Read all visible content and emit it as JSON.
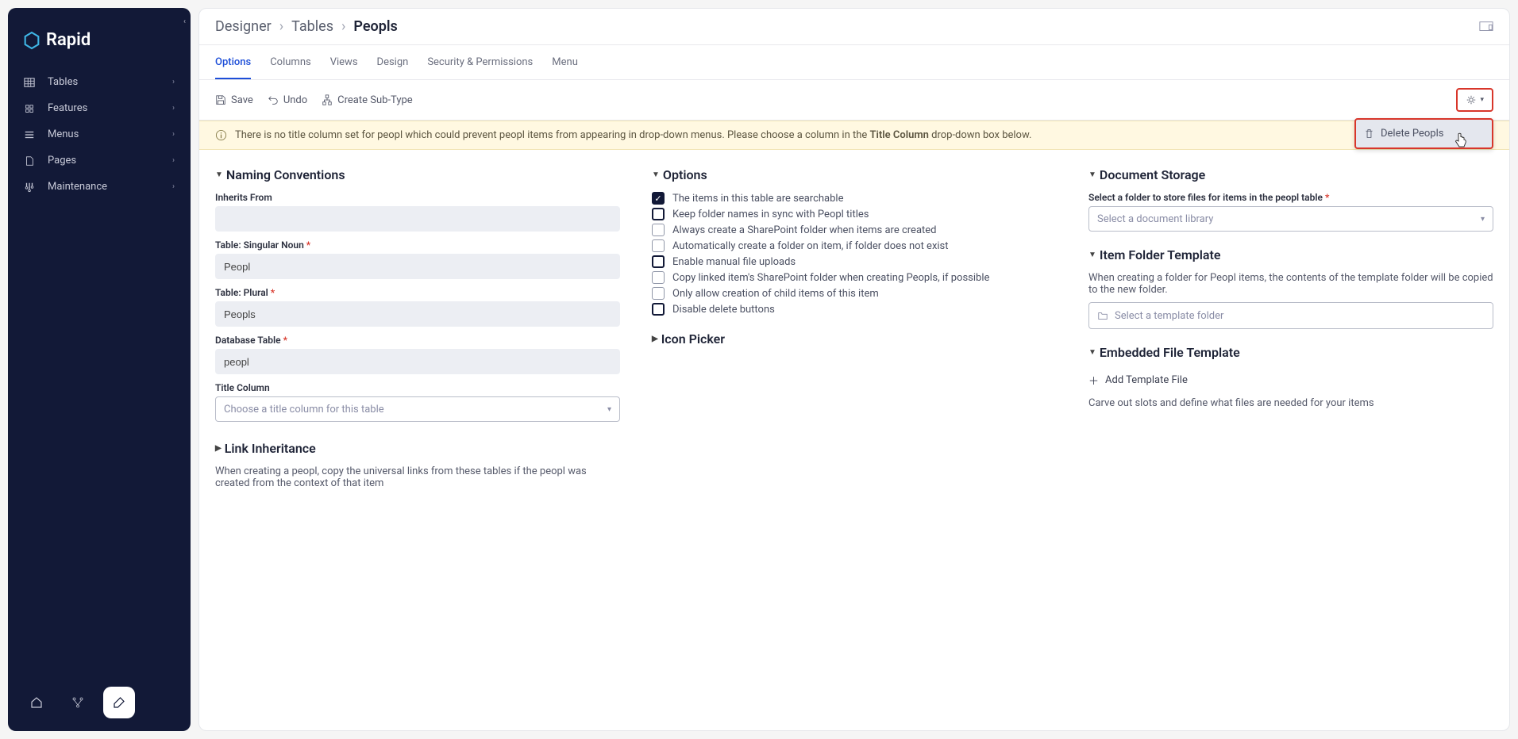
{
  "brand": {
    "name": "Rapid"
  },
  "sidebar": {
    "items": [
      {
        "label": "Tables"
      },
      {
        "label": "Features"
      },
      {
        "label": "Menus"
      },
      {
        "label": "Pages"
      },
      {
        "label": "Maintenance"
      }
    ]
  },
  "breadcrumb": {
    "a": "Designer",
    "b": "Tables",
    "c": "Peopls"
  },
  "tabs": [
    "Options",
    "Columns",
    "Views",
    "Design",
    "Security & Permissions",
    "Menu"
  ],
  "toolbar": {
    "save": "Save",
    "undo": "Undo",
    "createSub": "Create Sub-Type"
  },
  "gearMenu": {
    "delete": "Delete Peopls"
  },
  "warning": {
    "pre": "There is no title column set for peopl which could prevent peopl items from appearing in drop-down menus. Please choose a column in the ",
    "bold": "Title Column",
    "post": " drop-down box below."
  },
  "naming": {
    "title": "Naming Conventions",
    "inheritsLabel": "Inherits From",
    "inheritsValue": "",
    "singularLabel": "Table: Singular Noun",
    "singularValue": "Peopl",
    "pluralLabel": "Table: Plural",
    "pluralValue": "Peopls",
    "dbLabel": "Database Table",
    "dbValue": "peopl",
    "titleColLabel": "Title Column",
    "titleColPlaceholder": "Choose a title column for this table"
  },
  "link": {
    "title": "Link Inheritance",
    "desc": "When creating a peopl, copy the universal links from these tables if the peopl was created from the context of that item"
  },
  "options": {
    "title": "Options",
    "items": [
      {
        "label": "The items in this table are searchable",
        "checked": true,
        "strong": true
      },
      {
        "label": "Keep folder names in sync with Peopl titles",
        "checked": false,
        "strong": true
      },
      {
        "label": "Always create a SharePoint folder when items are created",
        "checked": false,
        "strong": false
      },
      {
        "label": "Automatically create a folder on item, if folder does not exist",
        "checked": false,
        "strong": false
      },
      {
        "label": "Enable manual file uploads",
        "checked": false,
        "strong": true
      },
      {
        "label": "Copy linked item's SharePoint folder when creating Peopls, if possible",
        "checked": false,
        "strong": false
      },
      {
        "label": "Only allow creation of child items of this item",
        "checked": false,
        "strong": false
      },
      {
        "label": "Disable delete buttons",
        "checked": false,
        "strong": true
      }
    ],
    "iconPicker": "Icon Picker"
  },
  "storage": {
    "title": "Document Storage",
    "selectLabel": "Select a folder to store files for items in the peopl table",
    "selectPlaceholder": "Select a document library",
    "itemTemplateTitle": "Item Folder Template",
    "itemTemplateDesc": "When creating a folder for Peopl items, the contents of the template folder will be copied to the new folder.",
    "templatePlaceholder": "Select a template folder",
    "embeddedTitle": "Embedded File Template",
    "addTemplate": "Add Template File",
    "embeddedDesc": "Carve out slots and define what files are needed for your items"
  }
}
